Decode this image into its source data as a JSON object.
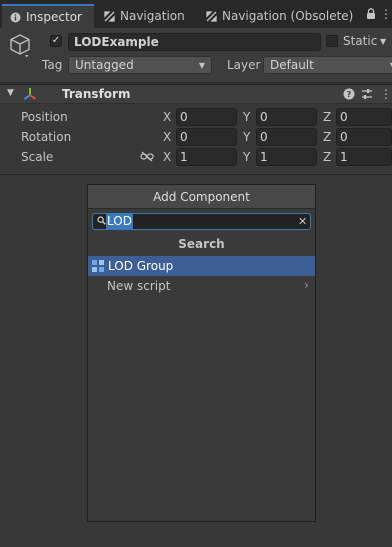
{
  "tabs": [
    {
      "label": "Inspector",
      "icon": "info-icon"
    },
    {
      "label": "Navigation",
      "icon": "navigation-icon"
    },
    {
      "label": "Navigation (Obsolete)",
      "icon": "navigation-icon"
    }
  ],
  "object": {
    "name": "LODExample",
    "active": true,
    "static_label": "Static",
    "tag_label": "Tag",
    "tag_value": "Untagged",
    "layer_label": "Layer",
    "layer_value": "Default"
  },
  "transform": {
    "title": "Transform",
    "rows": [
      {
        "label": "Position",
        "x": "0",
        "y": "0",
        "z": "0"
      },
      {
        "label": "Rotation",
        "x": "0",
        "y": "0",
        "z": "0"
      },
      {
        "label": "Scale",
        "x": "1",
        "y": "1",
        "z": "1"
      }
    ],
    "axis_x": "X",
    "axis_y": "Y",
    "axis_z": "Z"
  },
  "add_component": {
    "title": "Add Component",
    "search_value": "LOD",
    "section": "Search",
    "results": [
      {
        "label": "LOD Group",
        "selected": true
      },
      {
        "label": "New script",
        "selected": false
      }
    ]
  },
  "colors": {
    "accent": "#3a79bb",
    "selection": "#3e5f96",
    "background": "#383838"
  }
}
